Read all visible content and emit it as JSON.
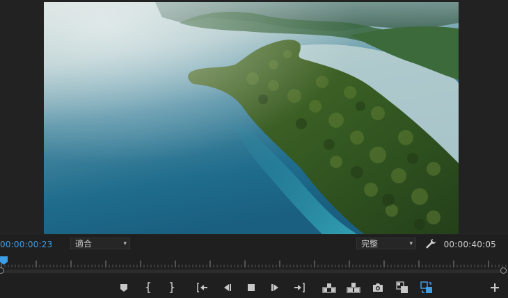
{
  "program_monitor": {
    "timecode_current": "00:00:00:23",
    "timecode_duration": "00:00:40:05",
    "zoom_select": {
      "value": "適合"
    },
    "playback_resolution_select": {
      "value": "完整"
    }
  },
  "colors": {
    "accent": "#3d9ee8",
    "background": "#1f1f1f",
    "icon": "#c8c8c8"
  },
  "playhead_position_fraction": 0.0,
  "transport_controls": [
    {
      "name": "add-marker",
      "icon": "marker-icon"
    },
    {
      "name": "mark-in",
      "icon": "mark-in-icon"
    },
    {
      "name": "mark-out",
      "icon": "mark-out-icon"
    },
    {
      "name": "go-to-in",
      "icon": "go-to-in-icon"
    },
    {
      "name": "step-back",
      "icon": "step-back-icon"
    },
    {
      "name": "stop",
      "icon": "stop-icon"
    },
    {
      "name": "step-forward",
      "icon": "step-forward-icon"
    },
    {
      "name": "go-to-out",
      "icon": "go-to-out-icon"
    },
    {
      "name": "lift",
      "icon": "lift-icon"
    },
    {
      "name": "extract",
      "icon": "extract-icon"
    },
    {
      "name": "export-frame",
      "icon": "camera-icon"
    },
    {
      "name": "comparison-view",
      "icon": "comparison-view-icon"
    },
    {
      "name": "toggle-proxies",
      "icon": "proxy-toggle-icon",
      "active": true
    },
    {
      "name": "button-editor",
      "icon": "plus-icon"
    }
  ]
}
